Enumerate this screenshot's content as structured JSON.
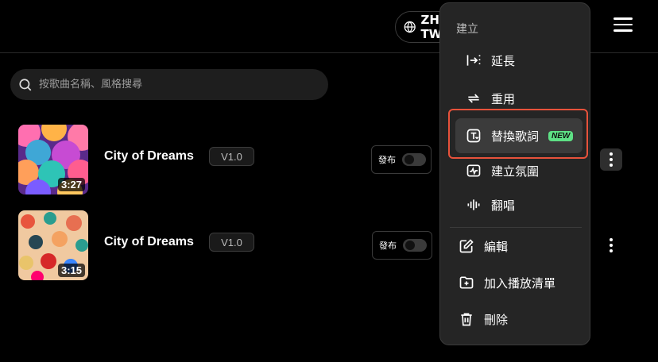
{
  "header": {
    "language": "ZH-TW"
  },
  "search": {
    "placeholder": "按歌曲名稱、風格搜尋"
  },
  "songs": [
    {
      "title": "City of Dreams",
      "version": "V1.0",
      "duration": "3:27",
      "publish_label": "發布"
    },
    {
      "title": "City of Dreams",
      "version": "V1.0",
      "duration": "3:15",
      "publish_label": "發布"
    }
  ],
  "dropdown": {
    "section_label": "建立",
    "items": [
      {
        "label": "延長",
        "icon": "extend-icon"
      },
      {
        "label": "重用",
        "icon": "reuse-icon"
      },
      {
        "label": "替換歌詞",
        "icon": "replace-lyrics-icon",
        "badge": "NEW"
      },
      {
        "label": "建立氛圍",
        "icon": "mood-icon"
      },
      {
        "label": "翻唱",
        "icon": "cover-icon"
      },
      {
        "label": "編輯",
        "icon": "edit-icon"
      },
      {
        "label": "加入播放清單",
        "icon": "add-playlist-icon"
      },
      {
        "label": "刪除",
        "icon": "delete-icon"
      }
    ]
  },
  "colors": {
    "highlight_border": "#e8523b",
    "new_badge": "#5ee085",
    "background": "#000000",
    "menu_bg": "#252525"
  }
}
